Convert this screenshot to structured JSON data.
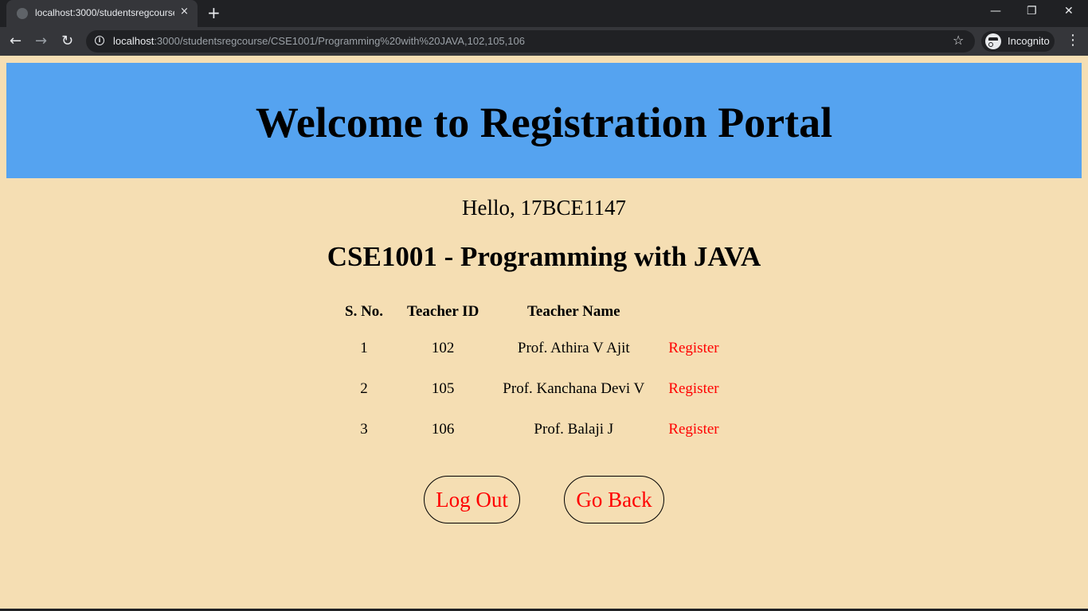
{
  "browser": {
    "tab_title": "localhost:3000/studentsregcourse",
    "url_host": "localhost",
    "url_rest": ":3000/studentsregcourse/CSE1001/Programming%20with%20JAVA,102,105,106",
    "profile_label": "Incognito"
  },
  "page": {
    "banner_title": "Welcome to Registration Portal",
    "greeting": "Hello, 17BCE1147",
    "course_heading": "CSE1001 - Programming with JAVA",
    "colors": {
      "banner": "#55a3f0",
      "background": "#f5deb3",
      "link": "#ff0000"
    }
  },
  "table": {
    "headers": [
      "S. No.",
      "Teacher ID",
      "Teacher Name",
      ""
    ],
    "rows": [
      {
        "sno": "1",
        "id": "102",
        "name": "Prof. Athira V Ajit",
        "action": "Register"
      },
      {
        "sno": "2",
        "id": "105",
        "name": "Prof. Kanchana Devi V",
        "action": "Register"
      },
      {
        "sno": "3",
        "id": "106",
        "name": "Prof. Balaji J",
        "action": "Register"
      }
    ]
  },
  "buttons": {
    "logout": "Log Out",
    "goback": "Go Back"
  },
  "icons": {
    "close": "×",
    "new_tab": "+",
    "minimize": "—",
    "restore": "❐",
    "window_close": "✕",
    "back": "←",
    "forward": "→",
    "reload": "↻",
    "info": "i",
    "star": "☆",
    "menu": "⋮"
  }
}
